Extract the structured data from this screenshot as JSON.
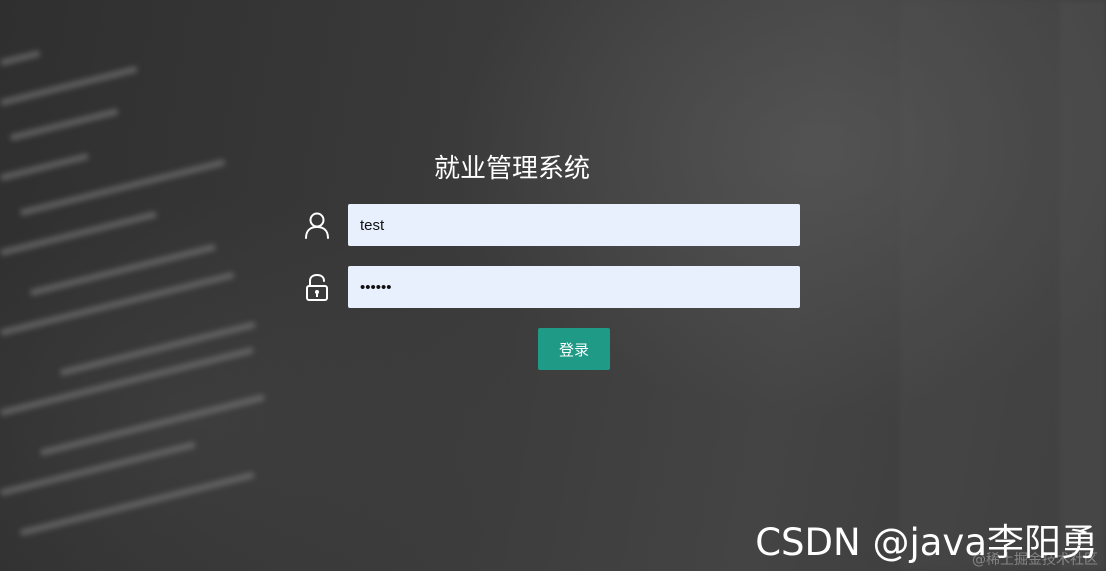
{
  "page": {
    "title": "就业管理系统"
  },
  "login_form": {
    "username": {
      "icon": "user-icon",
      "value": "test"
    },
    "password": {
      "icon": "unlock-icon",
      "value": "••••••"
    },
    "submit_label": "登录"
  },
  "watermark": {
    "text": "CSDN @java李阳勇",
    "subtext": "@稀土掘金技术社区"
  },
  "colors": {
    "background": "#3b3b3b",
    "input_background": "#e8f0fe",
    "button": "#1e9a86",
    "title_text": "#ffffff"
  }
}
